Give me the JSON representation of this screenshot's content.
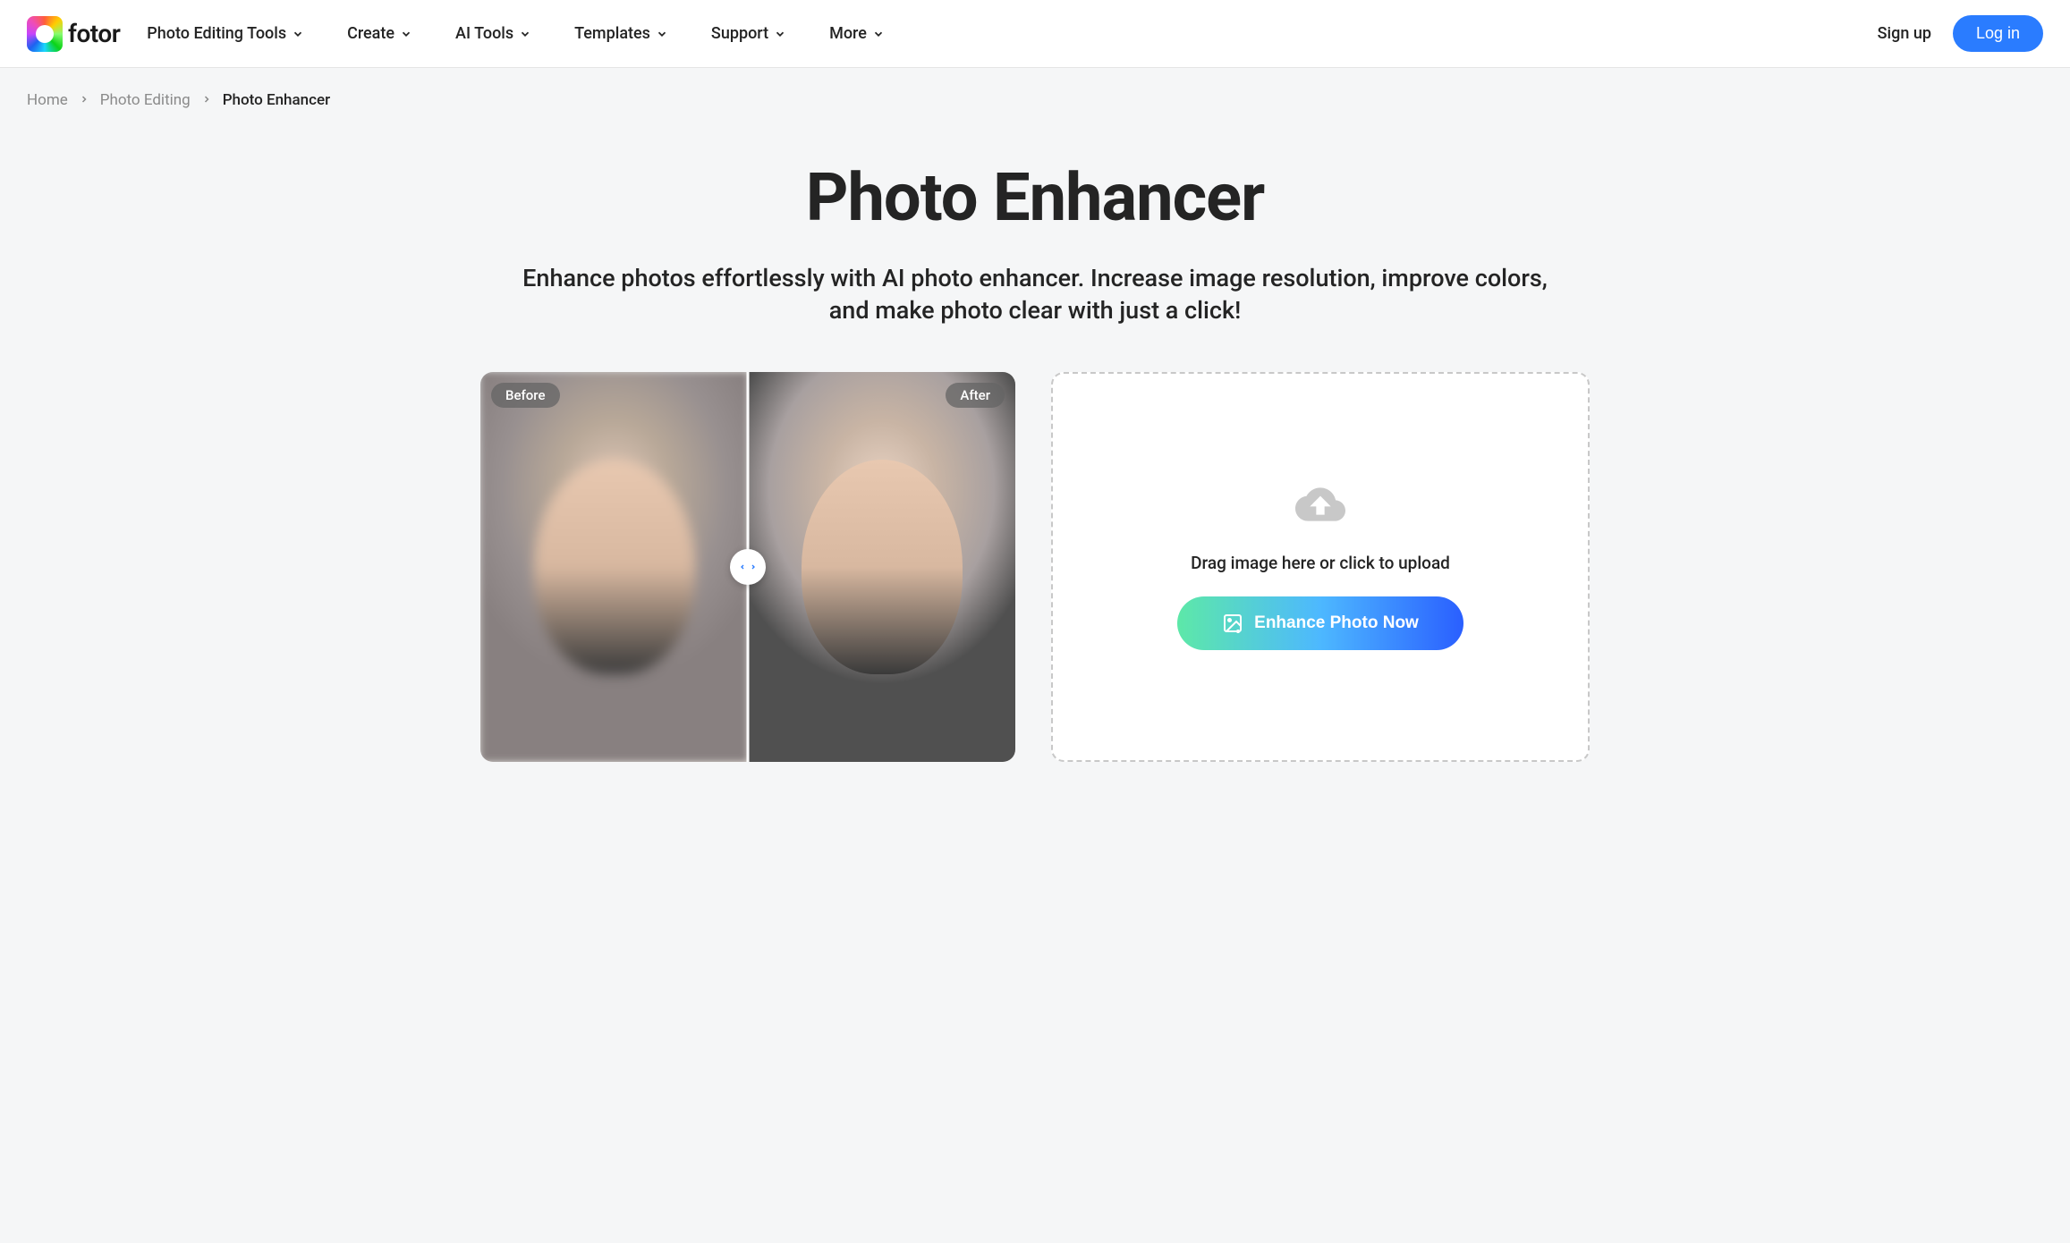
{
  "header": {
    "logo_text": "fotor",
    "nav": [
      {
        "label": "Photo Editing Tools"
      },
      {
        "label": "Create"
      },
      {
        "label": "AI Tools"
      },
      {
        "label": "Templates"
      },
      {
        "label": "Support"
      },
      {
        "label": "More"
      }
    ],
    "signup_label": "Sign up",
    "login_label": "Log in"
  },
  "breadcrumb": {
    "items": [
      {
        "label": "Home",
        "current": false
      },
      {
        "label": "Photo Editing",
        "current": false
      },
      {
        "label": "Photo Enhancer",
        "current": true
      }
    ]
  },
  "hero": {
    "title": "Photo Enhancer",
    "subtitle": "Enhance photos effortlessly with AI photo enhancer. Increase image resolution, improve colors, and make photo clear with just a click!"
  },
  "compare": {
    "before_label": "Before",
    "after_label": "After"
  },
  "upload": {
    "instruction": "Drag image here or click to upload",
    "button_label": "Enhance Photo Now"
  }
}
